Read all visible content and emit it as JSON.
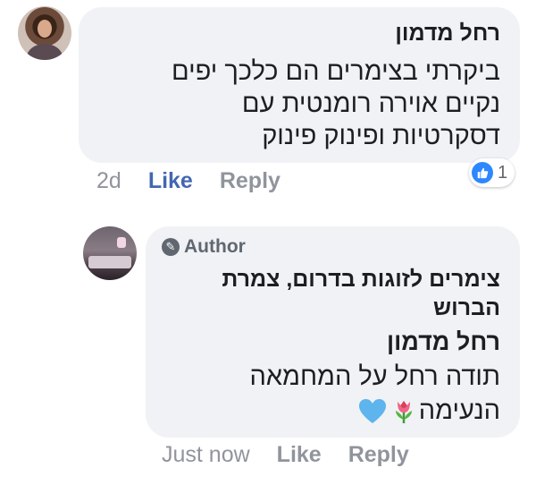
{
  "comment": {
    "author": "רחל מדמון",
    "lines": [
      "ביקרתי בצימרים הם כלכך יפים",
      "נקיים  אוירה רומנטית  עם",
      "דסקרטיות ופינוק פינוק"
    ],
    "time": "2d",
    "like_label": "Like",
    "reply_label": "Reply",
    "reaction_count": "1",
    "reaction_icon": "thumbs-up-icon",
    "reaction_color": "#2d88ff",
    "like_active_color": "#4267b2"
  },
  "reply": {
    "badge_label": "Author",
    "badge_icon": "pencil-icon",
    "page_name_line1": "צימרים לזוגות בדרום, צמרת",
    "page_name_line2": "הברוש",
    "mention": "רחל מדמון",
    "text_line1": "תודה רחל על המחמאה",
    "text_line2": "הנעימה",
    "emojis": [
      "tulip-emoji",
      "blue-heart-emoji"
    ],
    "time": "Just now",
    "like_label": "Like",
    "reply_label": "Reply"
  },
  "colors": {
    "bubble_bg": "#f0f2f5",
    "muted_text": "#90949c"
  }
}
